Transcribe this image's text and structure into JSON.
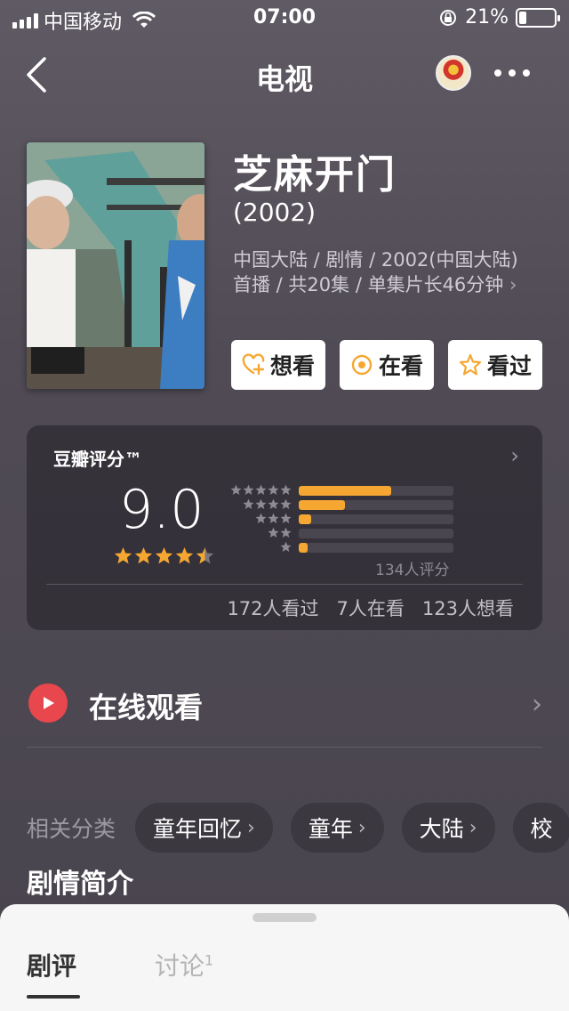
{
  "status_bar": {
    "carrier": "中国移动",
    "time": "07:00",
    "battery": "21%",
    "battery_level": 0.21
  },
  "nav": {
    "title": "电视"
  },
  "show": {
    "title": "芝麻开门",
    "year": "(2002)",
    "meta_line1": "中国大陆 / 剧情 / 2002(中国大陆)",
    "meta_line2": "首播 / 共20集 / 单集片长46分钟"
  },
  "actions": [
    {
      "label": "想看",
      "icon": "heart-plus-icon"
    },
    {
      "label": "在看",
      "icon": "target-icon"
    },
    {
      "label": "看过",
      "icon": "star-outline-icon"
    }
  ],
  "rating": {
    "label": "豆瓣评分™",
    "score": "9.0",
    "stars": 4.5,
    "distribution": [
      {
        "stars": 5,
        "fraction": 0.6
      },
      {
        "stars": 4,
        "fraction": 0.3
      },
      {
        "stars": 3,
        "fraction": 0.08
      },
      {
        "stars": 2,
        "fraction": 0.0
      },
      {
        "stars": 1,
        "fraction": 0.06
      }
    ],
    "count": "134人评分",
    "seen": "172人看过",
    "watching": "7人在看",
    "want": "123人想看"
  },
  "watch": {
    "label": "在线观看"
  },
  "categories": {
    "label": "相关分类",
    "items": [
      "童年回忆",
      "童年",
      "大陆",
      "校"
    ]
  },
  "synopsis_title": "剧情简介",
  "sheet": {
    "tab_review": "剧评",
    "tab_discuss": "讨论",
    "discuss_count": "1"
  },
  "colors": {
    "accent": "#f5a731",
    "play": "#e8474e"
  }
}
